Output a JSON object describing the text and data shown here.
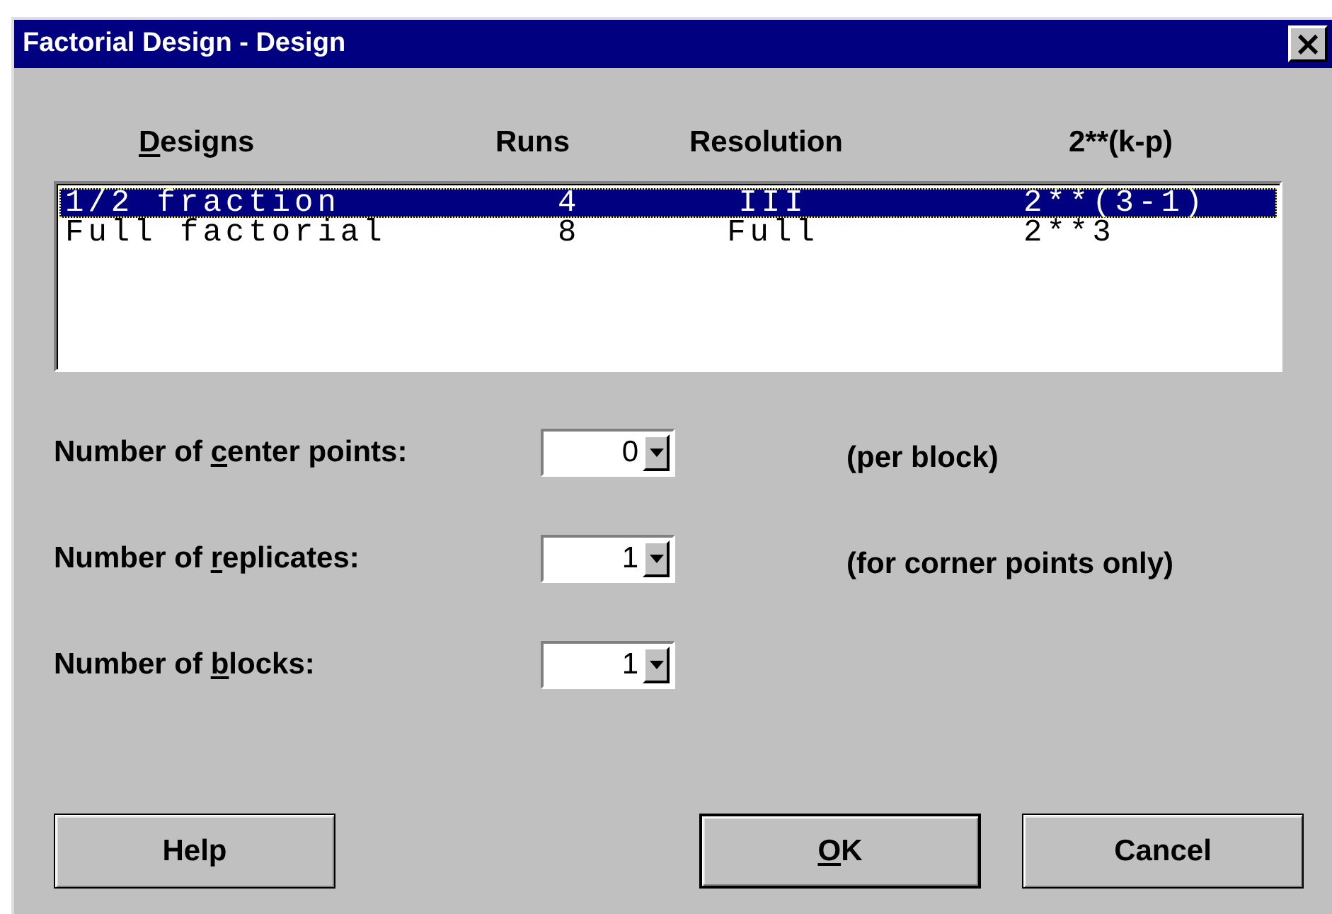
{
  "window": {
    "title": "Factorial Design - Design",
    "close": "×"
  },
  "design_list": {
    "columns": [
      {
        "label": {
          "key": "D",
          "after": "esigns"
        }
      },
      {
        "label": "Runs"
      },
      {
        "label": "Resolution"
      },
      {
        "label": "2**(k-p)"
      }
    ],
    "rows": [
      {
        "cells": [
          "1/2 fraction",
          "4",
          "III",
          "2**(3-1)"
        ],
        "selected": true
      },
      {
        "cells": [
          "Full factorial",
          "8",
          "Full",
          "2**3"
        ],
        "selected": false
      }
    ]
  },
  "fields": [
    {
      "label": {
        "before": "Number of ",
        "key": "c",
        "after": "enter points:"
      },
      "value": "0",
      "note": "(per block)"
    },
    {
      "label": {
        "before": "Number of ",
        "key": "r",
        "after": "eplicates:"
      },
      "value": "1",
      "note": "(for corner points only)"
    },
    {
      "label": {
        "before": "Number of ",
        "key": "b",
        "after": "locks:"
      },
      "value": "1"
    }
  ],
  "buttons": [
    {
      "label": "Help",
      "default": false
    },
    {
      "label": {
        "key": "O",
        "after": "K"
      },
      "default": true
    },
    {
      "label": "Cancel",
      "default": false
    }
  ]
}
